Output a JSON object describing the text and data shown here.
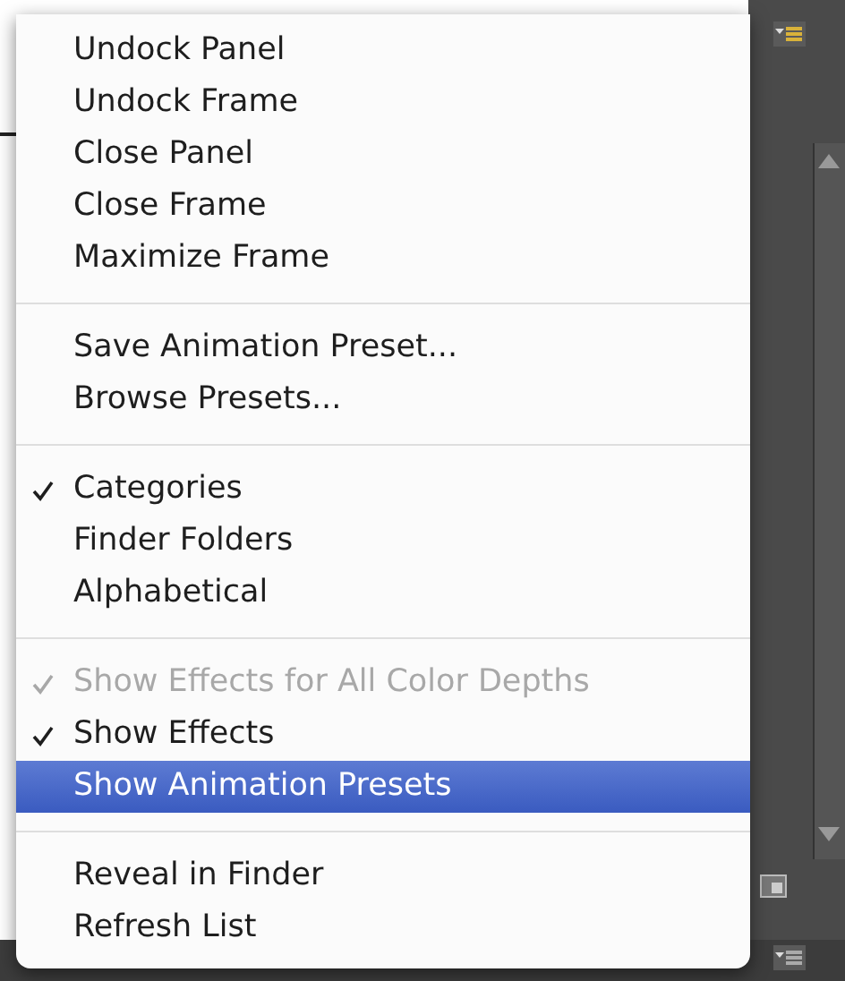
{
  "menu": {
    "groups": [
      {
        "items": [
          {
            "label": "Undock Panel",
            "checked": false,
            "disabled": false,
            "selected": false
          },
          {
            "label": "Undock Frame",
            "checked": false,
            "disabled": false,
            "selected": false
          },
          {
            "label": "Close Panel",
            "checked": false,
            "disabled": false,
            "selected": false
          },
          {
            "label": "Close Frame",
            "checked": false,
            "disabled": false,
            "selected": false
          },
          {
            "label": "Maximize Frame",
            "checked": false,
            "disabled": false,
            "selected": false
          }
        ]
      },
      {
        "items": [
          {
            "label": "Save Animation Preset...",
            "checked": false,
            "disabled": false,
            "selected": false
          },
          {
            "label": "Browse Presets...",
            "checked": false,
            "disabled": false,
            "selected": false
          }
        ]
      },
      {
        "items": [
          {
            "label": "Categories",
            "checked": true,
            "disabled": false,
            "selected": false
          },
          {
            "label": "Finder Folders",
            "checked": false,
            "disabled": false,
            "selected": false
          },
          {
            "label": "Alphabetical",
            "checked": false,
            "disabled": false,
            "selected": false
          }
        ]
      },
      {
        "items": [
          {
            "label": "Show Effects for All Color Depths",
            "checked": true,
            "disabled": true,
            "selected": false
          },
          {
            "label": "Show Effects",
            "checked": true,
            "disabled": false,
            "selected": false
          },
          {
            "label": "Show Animation Presets",
            "checked": false,
            "disabled": false,
            "selected": true
          }
        ]
      },
      {
        "items": [
          {
            "label": "Reveal in Finder",
            "checked": false,
            "disabled": false,
            "selected": false
          },
          {
            "label": "Refresh List",
            "checked": false,
            "disabled": false,
            "selected": false
          }
        ]
      }
    ]
  }
}
